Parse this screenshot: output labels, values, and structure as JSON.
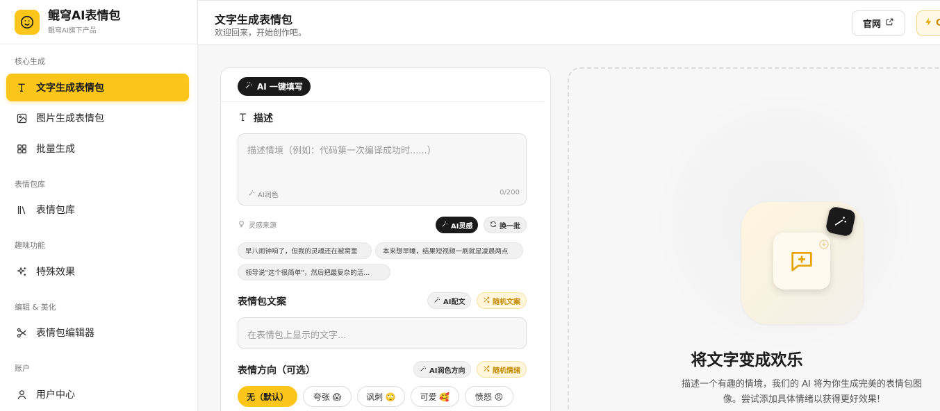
{
  "brand": {
    "title": "鲲穹AI表情包",
    "subtitle": "鲲穹AI旗下产品"
  },
  "sidebar": {
    "sections": [
      {
        "label": "核心生成"
      },
      {
        "label": "表情包库"
      },
      {
        "label": "趣味功能"
      },
      {
        "label": "编辑 & 美化"
      },
      {
        "label": "账户"
      }
    ],
    "items": [
      {
        "label": "文字生成表情包",
        "icon": "text-icon",
        "active": true
      },
      {
        "label": "图片生成表情包",
        "icon": "image-icon"
      },
      {
        "label": "批量生成",
        "icon": "grid-icon"
      },
      {
        "label": "表情包库",
        "icon": "library-icon"
      },
      {
        "label": "特殊效果",
        "icon": "sparkles-icon"
      },
      {
        "label": "表情包编辑器",
        "icon": "scissors-icon"
      },
      {
        "label": "用户中心",
        "icon": "user-icon"
      }
    ]
  },
  "header": {
    "title": "文字生成表情包",
    "subtitle": "欢迎回来，开始创作吧。",
    "site_button": "官网",
    "credit_button": "C"
  },
  "form": {
    "ai_fill_button": "AI 一键填写",
    "description_label": "描述",
    "description_placeholder": "描述情境（例如：代码第一次编译成功时......）",
    "polish_label": "AI润色",
    "char_count": "0/200",
    "inspiration_label": "灵感来源",
    "ai_inspiration_button": "AI灵感",
    "refresh_button": "换一批",
    "suggestions": [
      "早八闹钟响了，但我的灵魂还在被窝里",
      "本来想早睡，结果短视频一刷就是凌晨两点",
      "领导说\"这个很简单\"，然后把最复杂的活..."
    ],
    "caption_label": "表情包文案",
    "ai_caption_button": "AI配文",
    "random_caption_button": "随机文案",
    "caption_placeholder": "在表情包上显示的文字...",
    "mood_label": "表情方向（可选）",
    "ai_mood_button": "AI润色方向",
    "random_mood_button": "随机情绪",
    "moods": [
      {
        "label": "无（默认）",
        "selected": true
      },
      {
        "label": "夸张 😱"
      },
      {
        "label": "讽刺 🙄"
      },
      {
        "label": "可爱 🥰"
      },
      {
        "label": "愤怒 😠"
      }
    ]
  },
  "preview": {
    "title": "将文字变成欢乐",
    "description": "描述一个有趣的情境，我们的 AI 将为你生成完美的表情包图像。尝试添加具体情绪以获得更好效果!"
  },
  "colors": {
    "accent": "#fcc51a",
    "dark": "#1a1a1a"
  }
}
